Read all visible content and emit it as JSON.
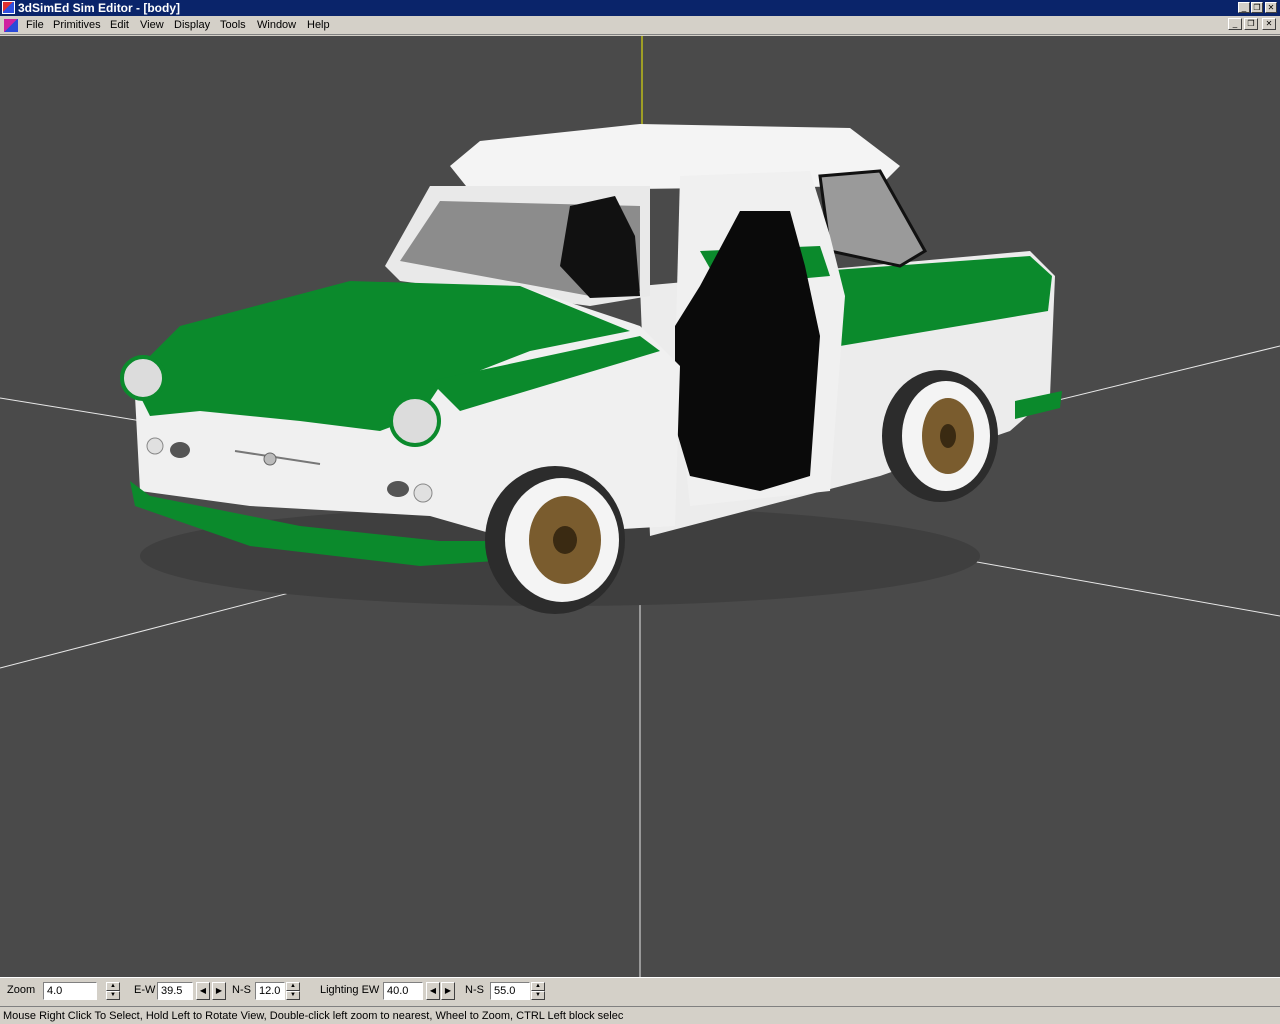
{
  "window": {
    "title": "3dSimEd Sim Editor - [body]",
    "caption_buttons": [
      "minimize",
      "restore",
      "close"
    ]
  },
  "menu": {
    "items": [
      "File",
      "Primitives",
      "Edit",
      "View",
      "Display",
      "Tools",
      "Window",
      "Help"
    ],
    "mdi_buttons": [
      "minimize",
      "restore",
      "close"
    ]
  },
  "viewport": {
    "background": "#4a4a4a",
    "car_colors": {
      "primary": "#0b8a2c",
      "secondary": "#f0f0f0",
      "seat": "#0a0a0a",
      "rim": "#7a5c2e"
    }
  },
  "toolbar": {
    "zoom": {
      "label": "Zoom",
      "value": "4.0"
    },
    "ew": {
      "label": "E-W",
      "value": "39.5"
    },
    "ns": {
      "label": "N-S",
      "value": "12.0"
    },
    "lighting_ew": {
      "label": "Lighting EW",
      "value": "40.0"
    },
    "lighting_ns": {
      "label": "N-S",
      "value": "55.0"
    }
  },
  "status": {
    "text": "Mouse Right Click To Select, Hold Left to Rotate View, Double-click left  zoom to nearest, Wheel to Zoom, CTRL Left block selec"
  }
}
